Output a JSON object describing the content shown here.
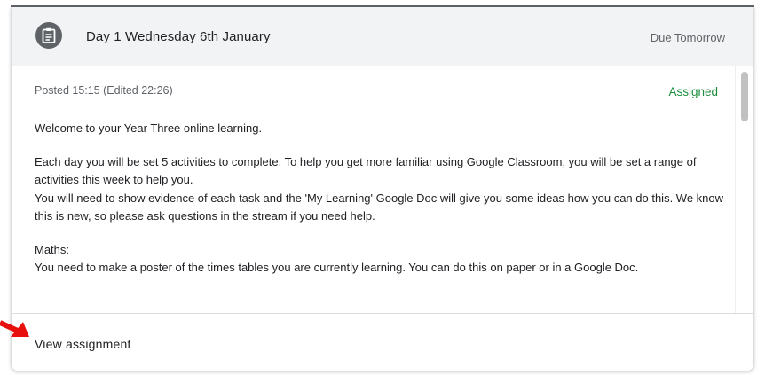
{
  "assignment": {
    "title": "Day 1 Wednesday 6th January",
    "due": "Due Tomorrow",
    "posted": "Posted 15:15 (Edited 22:26)",
    "status": "Assigned",
    "status_color": "#1e8e3e",
    "icon": "assignment-icon",
    "paragraphs": [
      [
        "Welcome to your Year Three online learning."
      ],
      [
        "Each day you will be set 5 activities to complete. To help you get more familiar using Google Classroom, you will be set a range of activities this week to help you.",
        "You will need to show evidence of each task and the 'My Learning' Google Doc will give you some ideas how you can do this.  We know this is new, so please ask questions in the stream if you need help."
      ],
      [
        "Maths:",
        "You need to make a poster of the times tables you are currently learning. You can do this on paper or in a Google Doc."
      ]
    ],
    "view_label": "View assignment"
  },
  "annotation": {
    "arrow_color": "#e8100c",
    "icon": "red-arrow-icon"
  }
}
